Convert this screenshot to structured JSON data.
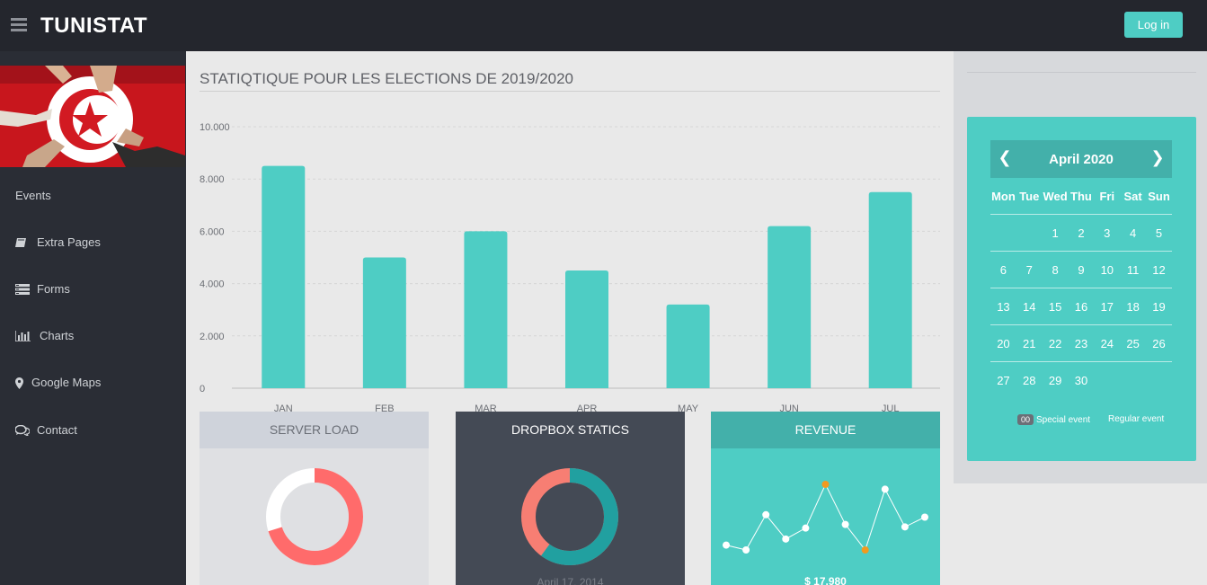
{
  "topbar": {
    "brand": "TUNISTAT",
    "login_label": "Log in"
  },
  "sidebar": {
    "items": [
      {
        "label": "Events",
        "icon": "none"
      },
      {
        "label": "Extra Pages",
        "icon": "book-icon"
      },
      {
        "label": "Forms",
        "icon": "tasks-icon"
      },
      {
        "label": "Charts",
        "icon": "bar-chart-icon"
      },
      {
        "label": "Google Maps",
        "icon": "map-marker-icon"
      },
      {
        "label": "Contact",
        "icon": "comments-icon"
      }
    ]
  },
  "main": {
    "title": "STATIQTIQUE POUR LES ELECTIONS DE 2019/2020"
  },
  "chart_data": {
    "type": "bar",
    "categories": [
      "JAN",
      "FEB",
      "MAR",
      "APR",
      "MAY",
      "JUN",
      "JUL"
    ],
    "values": [
      8500,
      5000,
      6000,
      4500,
      3200,
      6200,
      7500
    ],
    "ylim": [
      0,
      10000
    ],
    "yticks": [
      "0",
      "2.000",
      "4.000",
      "6.000",
      "8.000",
      "10.000"
    ],
    "bar_color": "#4ecdc4",
    "grid": true,
    "title": "",
    "xlabel": "",
    "ylabel": ""
  },
  "panels": {
    "server_load": {
      "title": "SERVER LOAD",
      "percent": 70,
      "color": "#ff6b6b"
    },
    "dropbox": {
      "title": "DROPBOX STATICS",
      "percent": 60,
      "color": "#21a0a0",
      "other_color": "#f77e73",
      "date": "April 17, 2014"
    },
    "revenue": {
      "title": "REVENUE",
      "amount": "$ 17,980",
      "trend": [
        3,
        2.6,
        5.5,
        3.5,
        4.4,
        8,
        4.7,
        2.6,
        7.6,
        4.5,
        5.3
      ]
    }
  },
  "calendar": {
    "month_label": "April 2020",
    "weekdays": [
      "Mon",
      "Tue",
      "Wed",
      "Thu",
      "Fri",
      "Sat",
      "Sun"
    ],
    "weeks": [
      [
        "",
        "",
        "1",
        "2",
        "3",
        "4",
        "5"
      ],
      [
        "6",
        "7",
        "8",
        "9",
        "10",
        "11",
        "12"
      ],
      [
        "13",
        "14",
        "15",
        "16",
        "17",
        "18",
        "19"
      ],
      [
        "20",
        "21",
        "22",
        "23",
        "24",
        "25",
        "26"
      ],
      [
        "27",
        "28",
        "29",
        "30",
        "",
        "",
        ""
      ]
    ],
    "legend": {
      "badge": "00",
      "special": "Special event",
      "regular": "Regular event"
    }
  },
  "colors": {
    "accent": "#4ecdc4",
    "topbar": "#24262d",
    "sidebar": "#2a2d35"
  }
}
